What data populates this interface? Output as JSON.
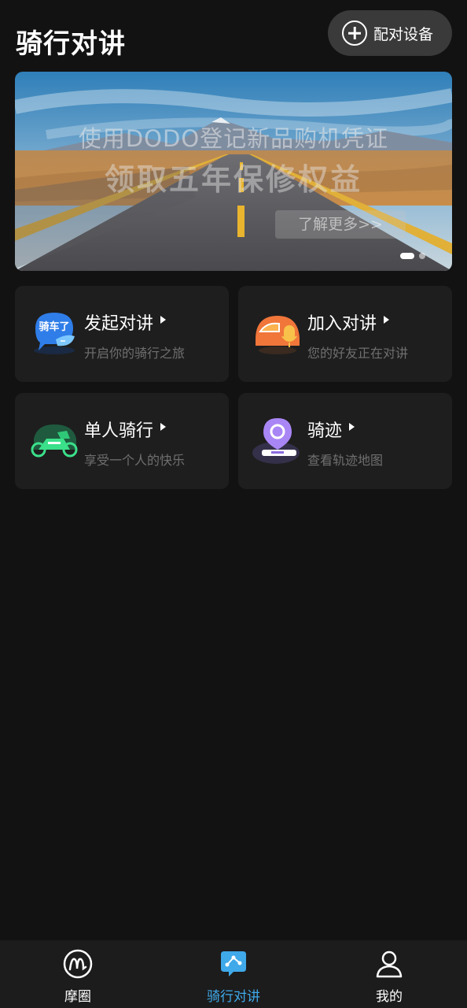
{
  "header": {
    "title": "骑行对讲",
    "pair_button_label": "配对设备"
  },
  "banner": {
    "line1": "使用DODO登记新品购机凭证",
    "line2": "领取五年保修权益",
    "cta": "了解更多>>",
    "page_count": 2,
    "active_page": 1
  },
  "cards": [
    {
      "title": "发起对讲",
      "subtitle": "开启你的骑行之旅",
      "icon": "chat-bubble-icon",
      "icon_text": "骑车了"
    },
    {
      "title": "加入对讲",
      "subtitle": "您的好友正在对讲",
      "icon": "helmet-mic-icon"
    },
    {
      "title": "单人骑行",
      "subtitle": "享受一个人的快乐",
      "icon": "motorcycle-icon"
    },
    {
      "title": "骑迹",
      "subtitle": "查看轨迹地图",
      "icon": "map-pin-icon"
    }
  ],
  "tabbar": {
    "items": [
      {
        "label": "摩圈",
        "icon": "mo-circle-icon",
        "active": false
      },
      {
        "label": "骑行对讲",
        "icon": "intercom-icon",
        "active": true
      },
      {
        "label": "我的",
        "icon": "person-icon",
        "active": false
      }
    ]
  },
  "colors": {
    "background": "#121212",
    "card": "#1e1e1e",
    "accent": "#3fa9ea",
    "subtitle": "#6f6f6f"
  }
}
